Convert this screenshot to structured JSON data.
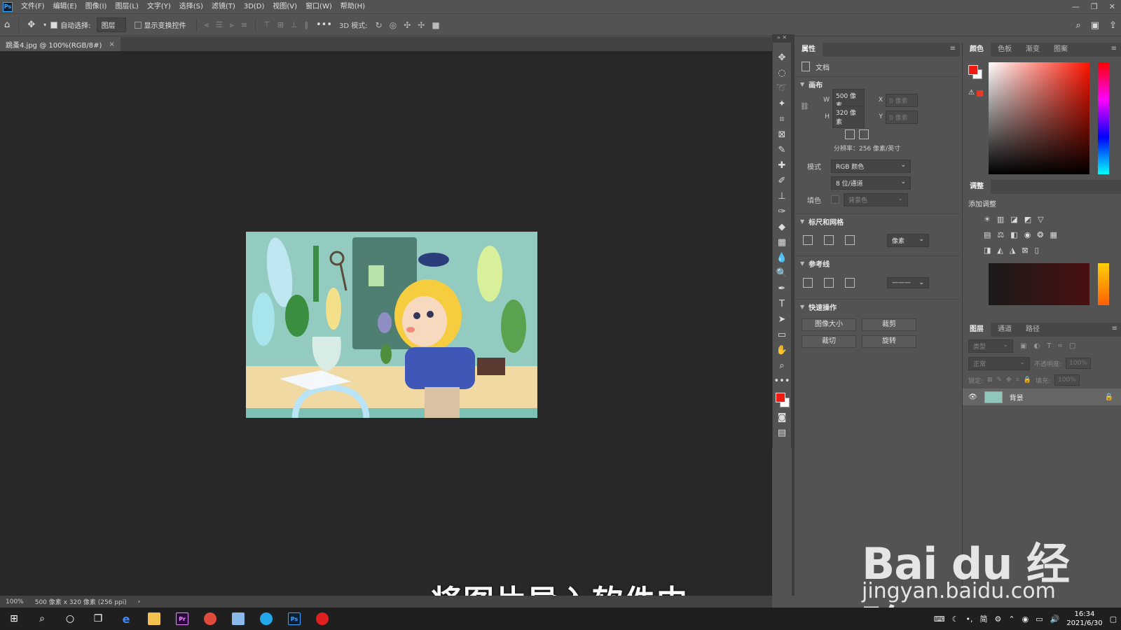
{
  "menubar": {
    "items": [
      "文件(F)",
      "编辑(E)",
      "图像(I)",
      "图层(L)",
      "文字(Y)",
      "选择(S)",
      "滤镜(T)",
      "3D(D)",
      "视图(V)",
      "窗口(W)",
      "帮助(H)"
    ],
    "window_controls": [
      "—",
      "❐",
      "✕"
    ]
  },
  "options_bar": {
    "auto_select_label": "自动选择:",
    "auto_select_value": "图层",
    "show_transform_label": "显示变换控件",
    "mode3d_label": "3D 模式:"
  },
  "document_tab": {
    "title": "跳蚤4.jpg @ 100%(RGB/8#)",
    "close": "×"
  },
  "subtitle": "将图片导入软件中",
  "status_bar": {
    "zoom": "100%",
    "info": "500 像素 x 320 像素 (256 ppi)",
    "arrow": "›"
  },
  "properties": {
    "tab": "属性",
    "doc_label": "文档",
    "canvas_section": "画布",
    "w_label": "W",
    "w_value": "500 像素",
    "h_label": "H",
    "h_value": "320 像素",
    "x_label": "X",
    "x_placeholder": "0 像素",
    "y_label": "Y",
    "y_placeholder": "0 像素",
    "resolution": "分辨率：256 像素/英寸",
    "mode_label": "模式",
    "mode_value": "RGB 颜色",
    "depth_value": "8 位/通道",
    "fill_label": "填色",
    "fill_value": "背景色",
    "rulers_section": "标尺和网格",
    "rulers_unit": "像素",
    "guides_section": "参考线",
    "quick_section": "快速操作",
    "btn_image_size": "图像大小",
    "btn_crop": "裁剪",
    "btn_trim": "裁切",
    "btn_rotate": "旋转"
  },
  "color_panel": {
    "tabs": [
      "颜色",
      "色板",
      "渐变",
      "图案"
    ],
    "fg_color": "#f01a14",
    "bg_color": "#ffffff"
  },
  "adjust_panel": {
    "tab": "调整",
    "add_label": "添加调整"
  },
  "layers_panel": {
    "tabs": [
      "图层",
      "通道",
      "路径"
    ],
    "search_placeholder": "类型",
    "blend_mode": "正常",
    "opacity_label": "不透明度:",
    "opacity_value": "100%",
    "lock_label": "锁定:",
    "fill_label": "填充:",
    "fill_value": "100%",
    "layer_name": "背景"
  },
  "taskbar": {
    "ime": "简",
    "time": "16:34",
    "date": "2021/6/30"
  },
  "watermark": {
    "brand": "Bai du 经验",
    "url": "jingyan.baidu.com"
  }
}
